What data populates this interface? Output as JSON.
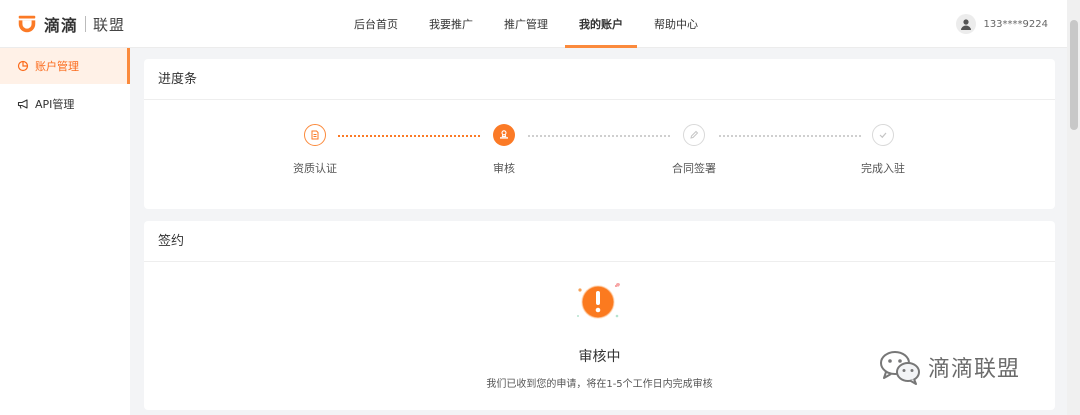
{
  "header": {
    "brand_primary": "滴滴",
    "brand_secondary": "联盟",
    "nav": [
      {
        "label": "后台首页",
        "active": false
      },
      {
        "label": "我要推广",
        "active": false
      },
      {
        "label": "推广管理",
        "active": false
      },
      {
        "label": "我的账户",
        "active": true
      },
      {
        "label": "帮助中心",
        "active": false
      }
    ],
    "user": {
      "phone": "133****9224",
      "icon": "user-icon"
    }
  },
  "sidebar": {
    "items": [
      {
        "label": "账户管理",
        "icon": "pie-chart-icon",
        "active": true
      },
      {
        "label": "API管理",
        "icon": "megaphone-icon",
        "active": false
      }
    ]
  },
  "progress": {
    "title": "进度条",
    "steps": [
      {
        "label": "资质认证",
        "state": "done",
        "icon": "document-icon"
      },
      {
        "label": "审核",
        "state": "current",
        "icon": "stamp-icon"
      },
      {
        "label": "合同签署",
        "state": "pending",
        "icon": "pen-icon"
      },
      {
        "label": "完成入驻",
        "state": "pending",
        "icon": "check-icon"
      }
    ]
  },
  "sign": {
    "title": "签约",
    "status_title": "审核中",
    "status_desc": "我们已收到您的申请，将在1-5个工作日内完成审核",
    "status_icon": "exclamation-icon"
  },
  "watermark": {
    "text": "滴滴联盟",
    "icon": "wechat-icon"
  },
  "colors": {
    "accent": "#fb7a26",
    "accent_light": "#fff1e7",
    "pending": "#d9d9d9"
  }
}
